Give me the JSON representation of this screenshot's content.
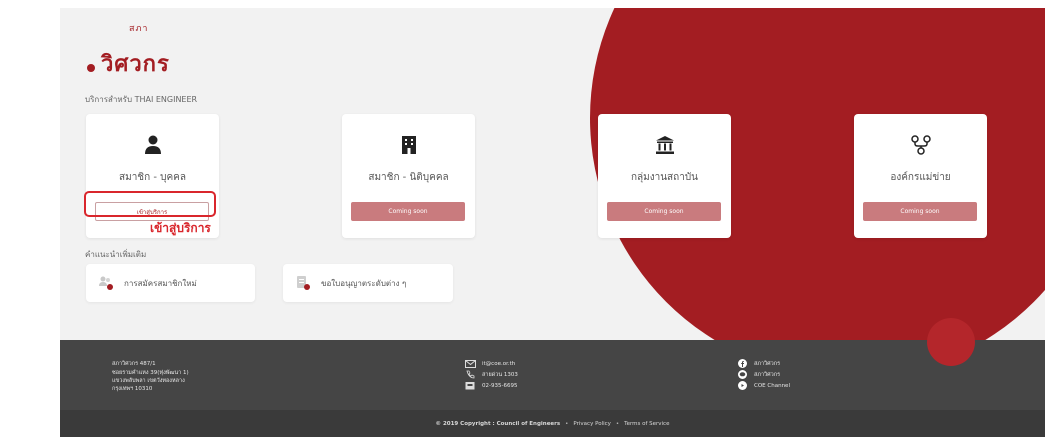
{
  "brand": {
    "small": "สภา",
    "name": "วิศวกร",
    "color": "#a31d22"
  },
  "subtitle": "บริการสำหรับ THAI ENGINEER",
  "cards": [
    {
      "icon": "person-icon",
      "title": "สมาชิก - บุคคล",
      "button": "เข้าสู่บริการ"
    },
    {
      "icon": "building-icon",
      "title": "สมาชิก - นิติบุคคล",
      "button": "Coming soon"
    },
    {
      "icon": "institution-icon",
      "title": "กลุ่มงานสถาบัน",
      "button": "Coming soon"
    },
    {
      "icon": "network-icon",
      "title": "องค์กรแม่ข่าย",
      "button": "Coming soon"
    }
  ],
  "annotation": "เข้าสู่บริการ",
  "more_label": "คำแนะนำเพิ่มเติม",
  "more_items": [
    {
      "icon": "new-member-icon",
      "label": "การสมัครสมาชิกใหม่"
    },
    {
      "icon": "license-icon",
      "label": "ขอใบอนุญาตระดับต่าง ๆ"
    }
  ],
  "footer": {
    "address": [
      "สภาวิศวกร 487/1",
      "ซอยรามคำแหง 39(ทุ่งพัฒนา 1)",
      "แขวงพลับพลา เขตวังทองหลาง",
      "กรุงเทพฯ 10310"
    ],
    "contact": {
      "email": "it@coe.or.th",
      "hotline": "สายด่วน 1303",
      "phone": "02-935-6695"
    },
    "social": {
      "facebook": "สภาวิศวกร",
      "line": "สภาวิศวกร",
      "youtube": "COE Channel"
    }
  },
  "bottom": {
    "copyright": "© 2019 Copyright : Council of Engineers",
    "privacy": "Privacy Policy",
    "terms": "Terms of Service",
    "separator": "•"
  },
  "colors": {
    "accent": "#a31d22",
    "footer": "#454545",
    "button_soon": "#c97b7e",
    "highlight": "#d9262c"
  }
}
